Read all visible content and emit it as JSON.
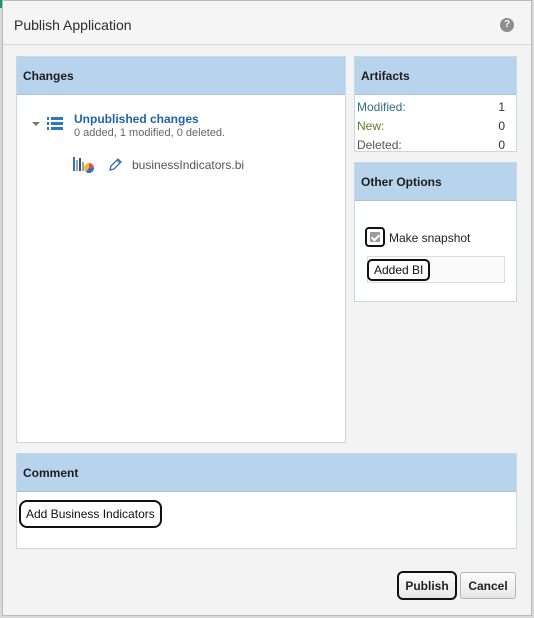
{
  "dialog": {
    "title": "Publish Application",
    "help_icon": "question-mark-icon"
  },
  "changes": {
    "header": "Changes",
    "group_title": "Unpublished changes",
    "summary": "0 added, 1 modified, 0 deleted.",
    "file_name": "businessIndicators.bi"
  },
  "artifacts": {
    "header": "Artifacts",
    "rows": [
      {
        "label": "Modified:",
        "value": "1"
      },
      {
        "label": "New:",
        "value": "0"
      },
      {
        "label": "Deleted:",
        "value": "0"
      }
    ]
  },
  "other_options": {
    "header": "Other Options",
    "snapshot_label": "Make snapshot",
    "snapshot_checked": true,
    "snapshot_name": "Added BI"
  },
  "comment": {
    "header": "Comment",
    "value": "Add Business Indicators"
  },
  "buttons": {
    "publish": "Publish",
    "cancel": "Cancel"
  },
  "colors": {
    "panel_header": "#b8d3ec",
    "link_blue": "#2162b0",
    "accent_green": "#0c9c74"
  }
}
